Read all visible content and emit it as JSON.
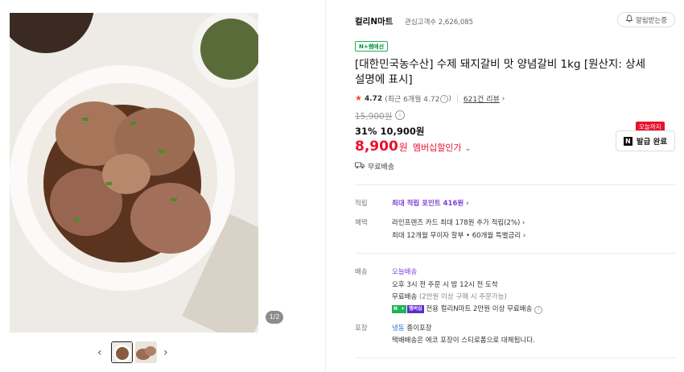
{
  "gallery": {
    "counter": "1/2",
    "prev_glyph": "‹",
    "next_glyph": "›"
  },
  "store": {
    "name": "컬리N마트",
    "fans": "관심고객수 2,626,085",
    "notify_label": "알림받는중"
  },
  "product": {
    "badge": "N+쌤에선",
    "title": "[대한민국농수산] 수제 돼지갈비 맛 양념갈비 1kg [원산지: 상세설명에 표시]",
    "rating": {
      "score": "4.72",
      "recent": "(최근 6개월 4.72",
      "recent_close": ")",
      "reviews": "621건 리뷰"
    },
    "original_price": "15,900원",
    "discount": "31%",
    "sale_price": "10,900원",
    "member_price": "8,900",
    "member_won": "원",
    "member_label": "멤버십할인가",
    "shipping": "무료배송"
  },
  "coupon": {
    "tag": "오늘까지",
    "label": "발급 완료"
  },
  "rows": {
    "points_label": "적립",
    "points_value": "최대 적립 포인트 416원",
    "benefit_label": "혜택",
    "benefit_line1": "라인프렌즈 카드 최대 178원 추가 적립(2%)",
    "benefit_line2": "최대 12개월 무이자 할부 • 60개월 특별금리",
    "delivery_label": "배송",
    "delivery_type": "오늘배송",
    "delivery_line1": "오후 3시 전 주문 시 밤 12시 전 도착",
    "delivery_line2": "무료배송",
    "delivery_line2_note": "(2만원 이상 구매 시 주문가능)",
    "delivery_np_a": "N",
    "delivery_np_b": "+",
    "delivery_np_c": "멤버십",
    "delivery_line3": "전용 컬리N마트 2만원 이상 무료배송",
    "pack_label": "포장",
    "pack_type": "냉동",
    "pack_type_rest": "종이포장",
    "pack_line2": "택배배송은 에코 포장이 스티로폼으로 대체됩니다."
  },
  "colors": {
    "accent_red": "#e8112d",
    "purple": "#7a3fd6",
    "green": "#1a9a4a"
  },
  "icons": [
    "bell-icon",
    "star-icon",
    "info-icon",
    "truck-icon",
    "chevron-right-icon",
    "chevron-down-icon",
    "naver-logo-icon"
  ]
}
